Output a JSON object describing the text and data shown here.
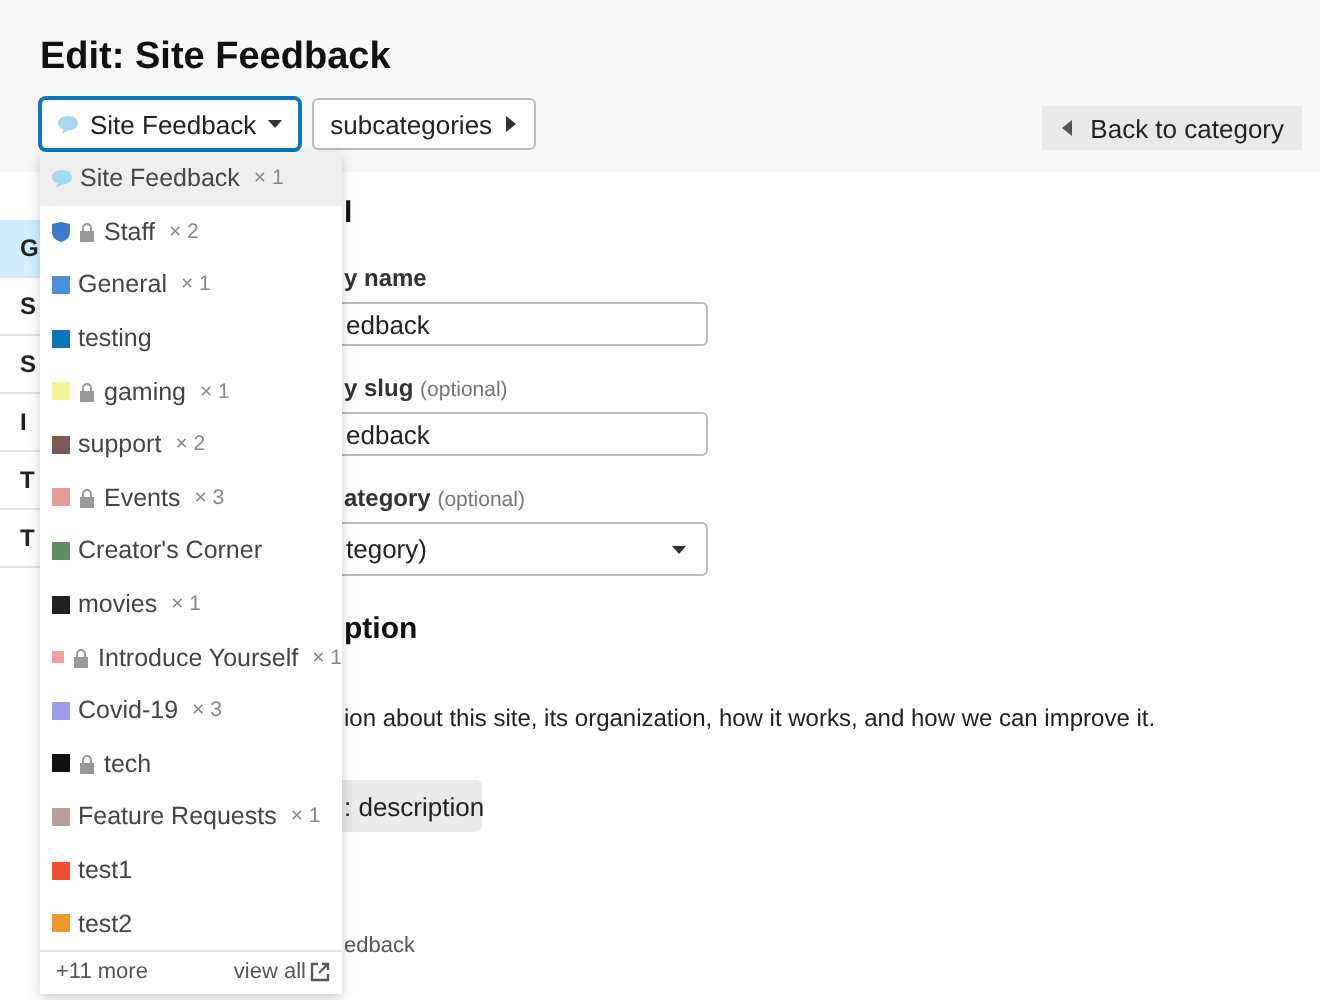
{
  "title": "Edit: Site Feedback",
  "category_button": {
    "label": "Site Feedback",
    "color": "#a8d8f0",
    "expanded": true
  },
  "subcategories_button": {
    "label": "subcategories"
  },
  "back_button": {
    "label": "Back to category"
  },
  "sidebar": {
    "items": [
      {
        "label": "G",
        "selected": true
      },
      {
        "label": "S",
        "selected": false
      },
      {
        "label": "S",
        "selected": false
      },
      {
        "label": "I",
        "selected": false
      },
      {
        "label": "T",
        "selected": false
      },
      {
        "label": "T",
        "selected": false
      }
    ]
  },
  "form": {
    "section_heading": "l",
    "name_label": "y name",
    "name_value": "edback",
    "slug_label": "y slug",
    "slug_hint": "(optional)",
    "slug_value": "edback",
    "parent_label": "ategory",
    "parent_hint": "(optional)",
    "parent_value": "tegory)",
    "description_heading": "ption",
    "description_text": "ion about this site, its organization, how it works, and how we can improve it.",
    "description_button": ": description",
    "footer_text": "edback"
  },
  "dropdown": {
    "items": [
      {
        "kind": "bubble",
        "label": "Site Feedback",
        "count": "× 1",
        "color": "#a8d8f0",
        "locked": false,
        "selected": true
      },
      {
        "kind": "shield",
        "label": "Staff",
        "count": "× 2",
        "color": "#3b7ac9",
        "locked": true,
        "selected": false
      },
      {
        "kind": "square",
        "label": "General",
        "count": "× 1",
        "color": "#4a90d9",
        "locked": false,
        "selected": false
      },
      {
        "kind": "square",
        "label": "testing",
        "color": "#0e76bd",
        "locked": false,
        "selected": false
      },
      {
        "kind": "square",
        "label": "gaming",
        "count": "× 1",
        "color": "#f5f39a",
        "locked": true,
        "selected": false
      },
      {
        "kind": "square",
        "label": "support",
        "count": "× 2",
        "color": "#7a5a52",
        "locked": false,
        "selected": false
      },
      {
        "kind": "square",
        "label": "Events",
        "count": "× 3",
        "color": "#e59a9a",
        "locked": true,
        "selected": false
      },
      {
        "kind": "square",
        "label": "Creator's Corner",
        "color": "#5e8f5e",
        "locked": false,
        "selected": false
      },
      {
        "kind": "square",
        "label": "movies",
        "count": "× 1",
        "color": "#222222",
        "locked": false,
        "selected": false
      },
      {
        "kind": "square",
        "label": "Introduce Yourself",
        "count": "× 1",
        "color": "#ee9f9f",
        "locked": true,
        "selected": false
      },
      {
        "kind": "square",
        "label": "Covid-19",
        "count": "× 3",
        "color": "#9d9df0",
        "locked": false,
        "selected": false
      },
      {
        "kind": "square",
        "label": "tech",
        "color": "#111111",
        "locked": true,
        "selected": false
      },
      {
        "kind": "square",
        "label": "Feature Requests",
        "count": "× 1",
        "color": "#b8a09a",
        "locked": false,
        "selected": false
      },
      {
        "kind": "square",
        "label": "test1",
        "color": "#f05030",
        "locked": false,
        "selected": false
      },
      {
        "kind": "square",
        "label": "test2",
        "color": "#f0962a",
        "locked": false,
        "selected": false
      }
    ],
    "more": "+11 more",
    "view_all": "view all"
  }
}
